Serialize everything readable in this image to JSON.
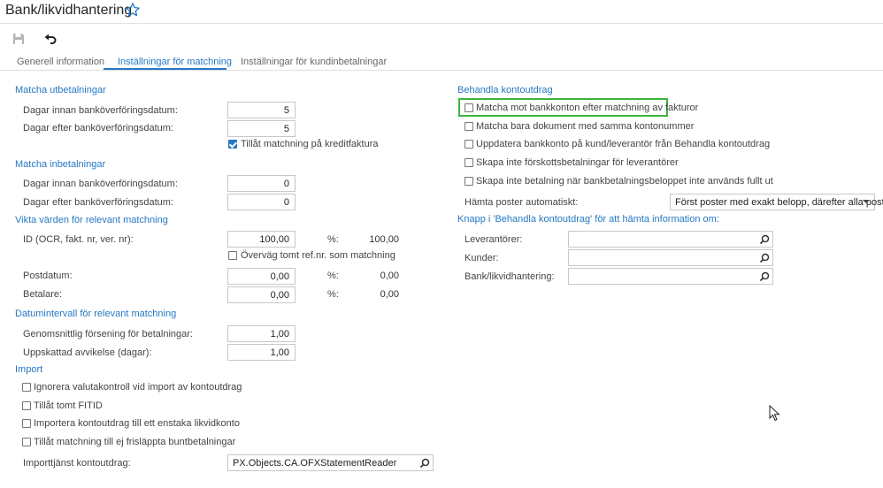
{
  "header": {
    "title": "Bank/likvidhantering",
    "favorite_icon": "star-outline-icon",
    "accent_color": "#2578c4"
  },
  "toolbar": {
    "save_icon": "save-icon",
    "undo_icon": "undo-icon"
  },
  "tabs": [
    {
      "label": "Generell information",
      "active": false
    },
    {
      "label": "Inställningar för matchning",
      "active": true
    },
    {
      "label": "Inställningar för kundinbetalningar",
      "active": false
    }
  ],
  "left": {
    "outgoing": {
      "title": "Matcha utbetalningar",
      "days_before_label": "Dagar innan banköverföringsdatum:",
      "days_before_value": "5",
      "days_after_label": "Dagar efter banköverföringsdatum:",
      "days_after_value": "5",
      "credit_invoice_label": "Tillåt matchning på kreditfaktura",
      "credit_invoice_checked": true
    },
    "incoming": {
      "title": "Matcha inbetalningar",
      "days_before_label": "Dagar innan banköverföringsdatum:",
      "days_before_value": "0",
      "days_after_label": "Dagar efter banköverföringsdatum:",
      "days_after_value": "0"
    },
    "weights": {
      "title": "Vikta värden för relevant matchning",
      "id_label": "ID (OCR, fakt. nr, ver. nr):",
      "id_value": "100,00",
      "id_pct_label": "%:",
      "id_pct_value": "100,00",
      "empty_ref_label": "Överväg tomt ref.nr. som matchning",
      "empty_ref_checked": false,
      "postdate_label": "Postdatum:",
      "postdate_value": "0,00",
      "postdate_pct_label": "%:",
      "postdate_pct_value": "0,00",
      "payer_label": "Betalare:",
      "payer_value": "0,00",
      "payer_pct_label": "%:",
      "payer_pct_value": "0,00"
    },
    "date_interval": {
      "title": "Datumintervall för relevant matchning",
      "avg_delay_label": "Genomsnittlig försening för betalningar:",
      "avg_delay_value": "1,00",
      "est_dev_label": "Uppskattad avvikelse (dagar):",
      "est_dev_value": "1,00"
    },
    "import": {
      "title": "Import",
      "options": [
        {
          "label": "Ignorera valutakontroll vid import av kontoutdrag",
          "checked": false
        },
        {
          "label": "Tillåt tomt FITID",
          "checked": false
        },
        {
          "label": "Importera kontoutdrag till ett enstaka likvidkonto",
          "checked": false
        },
        {
          "label": "Tillåt matchning till ej frisläppta buntbetalningar",
          "checked": false
        }
      ],
      "service_label": "Importtjänst kontoutdrag:",
      "service_value": "PX.Objects.CA.OFXStatementReader"
    }
  },
  "right": {
    "process": {
      "title": "Behandla kontoutdrag",
      "options": [
        {
          "label": "Matcha mot bankkonton efter matchning av fakturor",
          "checked": false
        },
        {
          "label": "Matcha bara dokument med samma kontonummer",
          "checked": false
        },
        {
          "label": "Uppdatera bankkonto på kund/leverantör från Behandla kontoutdrag",
          "checked": false
        },
        {
          "label": "Skapa inte förskottsbetalningar för leverantörer",
          "checked": false
        },
        {
          "label": "Skapa inte betalning när bankbetalningsbeloppet inte används fullt ut",
          "checked": false
        }
      ],
      "fetch_label": "Hämta poster automatiskt:",
      "fetch_value": "Först poster med exakt belopp, därefter alla poster",
      "highlight_color": "#3cb43c"
    },
    "button_info": {
      "title": "Knapp i 'Behandla kontoutdrag' för att hämta information om:",
      "vendors_label": "Leverantörer:",
      "vendors_value": "",
      "customers_label": "Kunder:",
      "customers_value": "",
      "bank_label": "Bank/likvidhantering:",
      "bank_value": ""
    }
  }
}
